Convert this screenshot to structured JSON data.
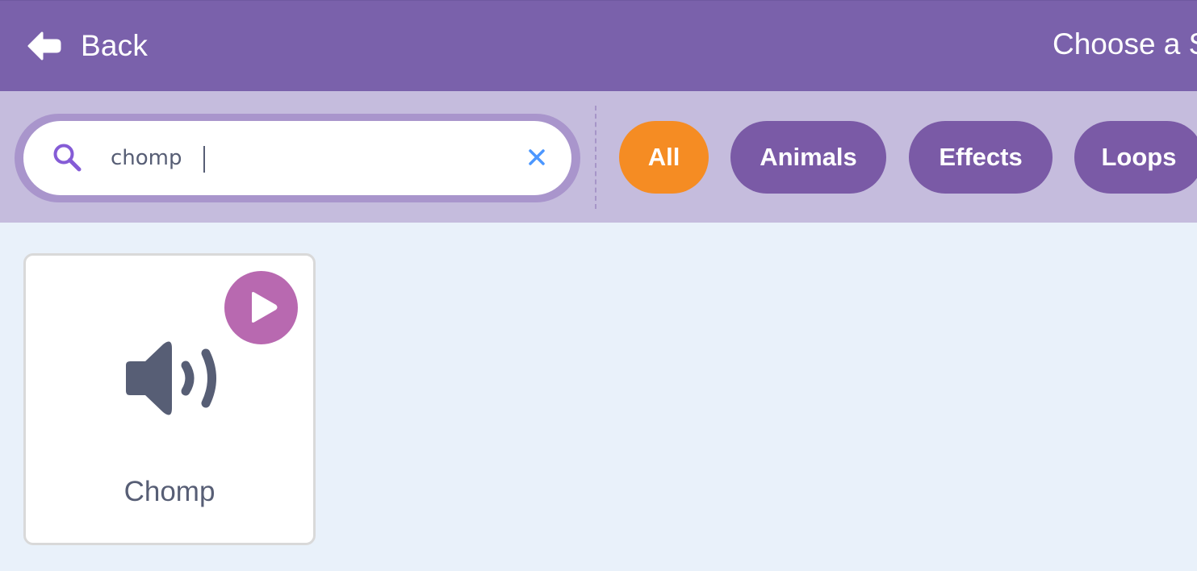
{
  "header": {
    "back_label": "Back",
    "back_icon": "back-arrow-icon",
    "title": "Choose a S"
  },
  "search": {
    "value": "chomp",
    "search_icon": "search-icon",
    "clear_icon": "close-icon"
  },
  "tags": [
    {
      "label": "All",
      "active": true
    },
    {
      "label": "Animals",
      "active": false
    },
    {
      "label": "Effects",
      "active": false
    },
    {
      "label": "Loops",
      "active": false
    }
  ],
  "library": {
    "items": [
      {
        "name": "Chomp",
        "icon": "speaker-icon",
        "play_icon": "play-icon"
      }
    ]
  },
  "colors": {
    "header_bg": "#7a61ab",
    "filter_bar_bg": "#c5bcdd",
    "tag_bg": "#7a5aa6",
    "tag_active_bg": "#f58c23",
    "play_button_bg": "#b869b0",
    "library_bg": "#e9f1fa",
    "text_gray": "#575e75"
  }
}
